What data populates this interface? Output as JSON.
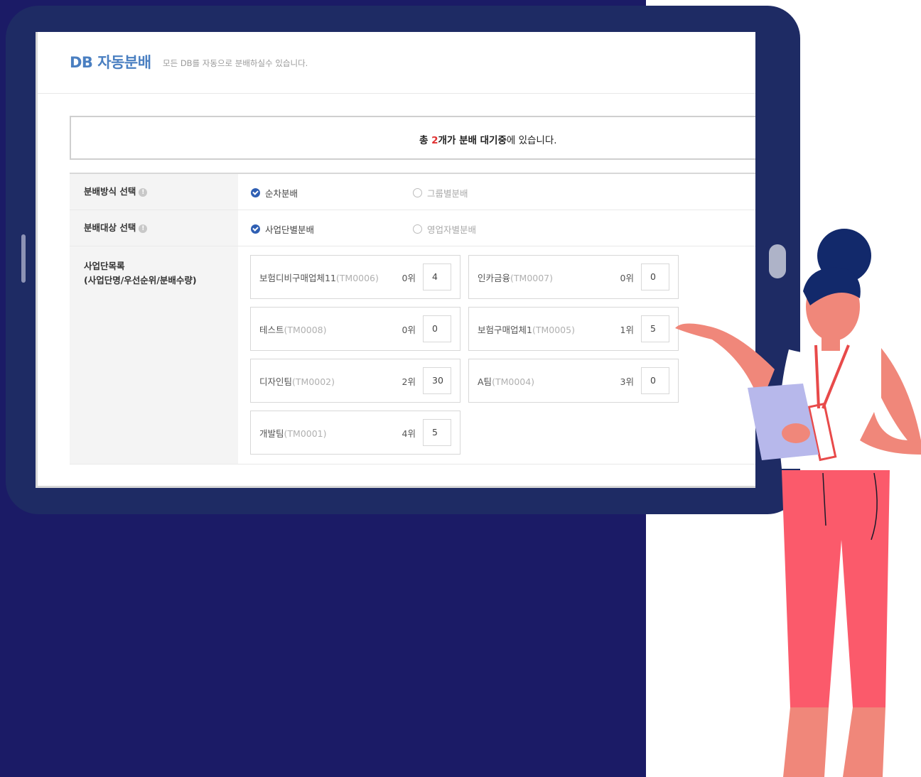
{
  "header": {
    "title": "DB 자동분배",
    "subtitle": "모든 DB를 자동으로 분배하실수 있습니다."
  },
  "notice": {
    "prefix": "총 ",
    "count": "2",
    "suffix_bold": "개가 분배 대기중",
    "suffix": "에 있습니다."
  },
  "form": {
    "method": {
      "label": "분배방식 선택",
      "options": [
        {
          "label": "순차분배",
          "checked": true
        },
        {
          "label": "그룹별분배",
          "checked": false
        }
      ]
    },
    "target": {
      "label": "분배대상 선택",
      "options": [
        {
          "label": "사업단별분배",
          "checked": true
        },
        {
          "label": "영업자별분배",
          "checked": false
        }
      ]
    },
    "list": {
      "label_line1": "사업단목록",
      "label_line2": "(사업단명/우선순위/분배수량)",
      "items": [
        {
          "name": "보험디비구매업체11",
          "code": "(TM0006)",
          "rank": "0위",
          "qty": "4"
        },
        {
          "name": "인카금융",
          "code": "(TM0007)",
          "rank": "0위",
          "qty": "0"
        },
        {
          "name": "테스트",
          "code": "(TM0008)",
          "rank": "0위",
          "qty": "0"
        },
        {
          "name": "보험구매업체1",
          "code": "(TM0005)",
          "rank": "1위",
          "qty": "5"
        },
        {
          "name": "디자인팀",
          "code": "(TM0002)",
          "rank": "2위",
          "qty": "30"
        },
        {
          "name": "A팀",
          "code": "(TM0004)",
          "rank": "3위",
          "qty": "0"
        },
        {
          "name": "개발팀",
          "code": "(TM0001)",
          "rank": "4위",
          "qty": "5"
        }
      ]
    }
  },
  "colors": {
    "background_navy": "#1b1b66",
    "tablet_frame": "#1e2b64",
    "title_blue": "#4a7fc1",
    "check_blue": "#2f5fb3",
    "count_red": "#e03131"
  },
  "icons": [
    "info-icon",
    "radio-checked-icon",
    "radio-unchecked-icon"
  ]
}
